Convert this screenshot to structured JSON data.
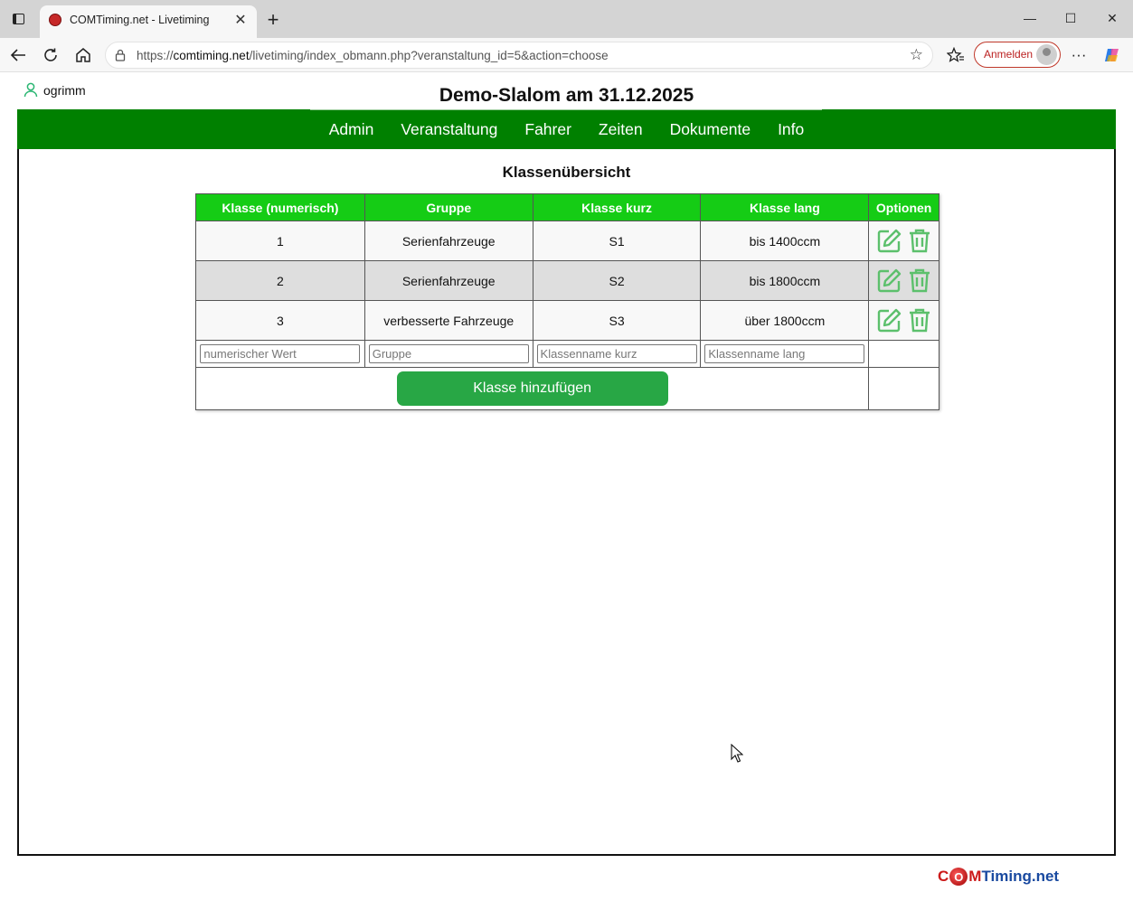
{
  "browser": {
    "tab_title": "COMTiming.net - Livetiming",
    "url_prefix": "https://",
    "url_host": "comtiming.net",
    "url_path": "/livetiming/index_obmann.php?veranstaltung_id=5&action=choose",
    "signin_label": "Anmelden"
  },
  "user": {
    "name": "ogrimm"
  },
  "page_title": "Demo-Slalom am 31.12.2025",
  "nav": [
    "Admin",
    "Veranstaltung",
    "Fahrer",
    "Zeiten",
    "Dokumente",
    "Info"
  ],
  "section_title": "Klassenübersicht",
  "table": {
    "headers": [
      "Klasse (numerisch)",
      "Gruppe",
      "Klasse kurz",
      "Klasse lang",
      "Optionen"
    ],
    "rows": [
      {
        "num": "1",
        "gruppe": "Serienfahrzeuge",
        "kurz": "S1",
        "lang": "bis 1400ccm"
      },
      {
        "num": "2",
        "gruppe": "Serienfahrzeuge",
        "kurz": "S2",
        "lang": "bis 1800ccm"
      },
      {
        "num": "3",
        "gruppe": "verbesserte Fahrzeuge",
        "kurz": "S3",
        "lang": "über 1800ccm"
      }
    ],
    "placeholders": {
      "num": "numerischer Wert",
      "gruppe": "Gruppe",
      "kurz": "Klassenname kurz",
      "lang": "Klassenname lang"
    },
    "add_button": "Klasse hinzufügen"
  },
  "footer_logo": {
    "part1": "C",
    "part2": "M",
    "part3": "Timing.net",
    "ball": "O"
  },
  "colors": {
    "nav_bg": "#008000",
    "table_header": "#15cc15",
    "add_button": "#28a745",
    "icon_green": "#5cc06c"
  }
}
